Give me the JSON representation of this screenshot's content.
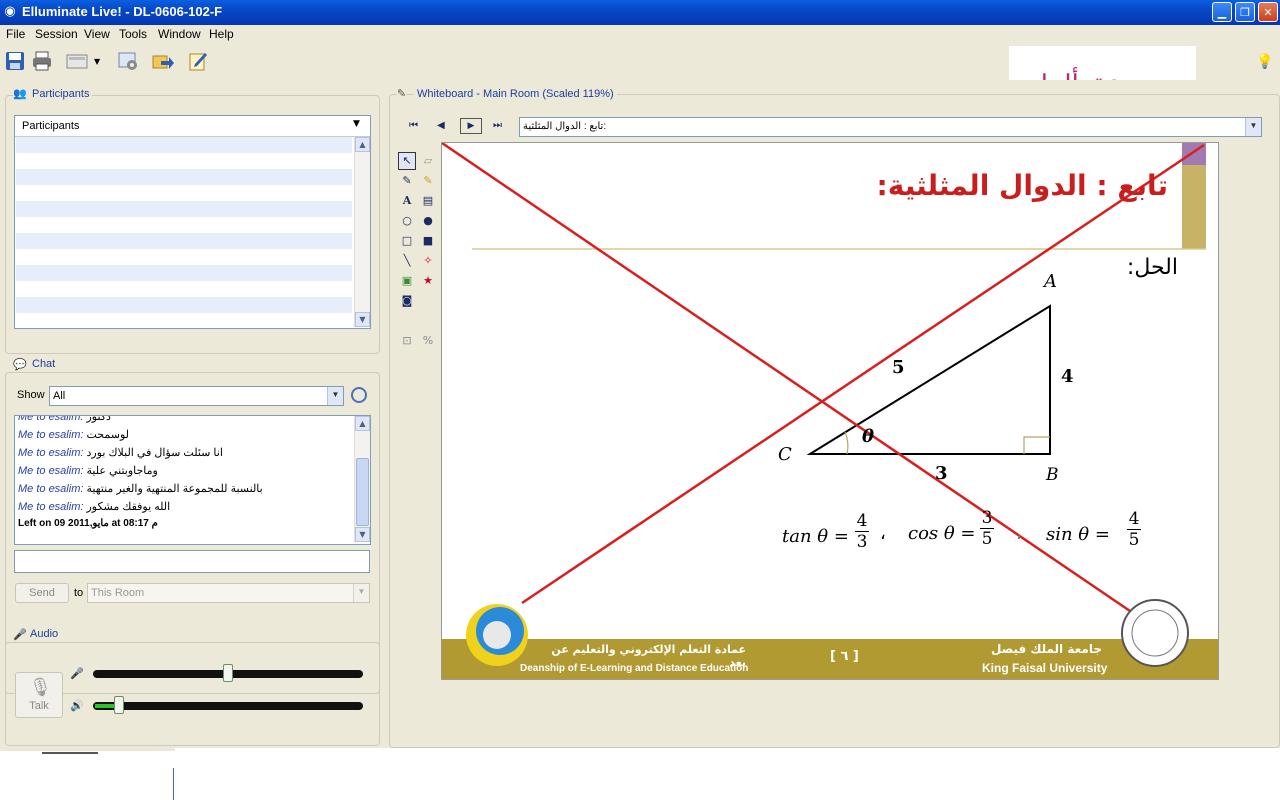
{
  "window": {
    "title": "Elluminate Live! - DL-0606-102-F"
  },
  "menu": [
    "File",
    "Session",
    "View",
    "Tools",
    "Window",
    "Help"
  ],
  "watermark": "عقدألماس",
  "participants": {
    "title": "Participants",
    "header": "Participants"
  },
  "chat": {
    "title": "Chat",
    "show_label": "Show",
    "show_value": "All",
    "messages": [
      {
        "who": "Me to esalim:",
        "text": "دكتور"
      },
      {
        "who": "Me to esalim:",
        "text": "لوسمحت"
      },
      {
        "who": "Me to esalim:",
        "text": "انا سئلت سؤال في البلاك بورد"
      },
      {
        "who": "Me to esalim:",
        "text": "وماجاوبتني علية"
      },
      {
        "who": "Me to esalim:",
        "text": "بالنسبة للمجموعة المنتهية والغير منتهية"
      },
      {
        "who": "Me to esalim:",
        "text": "الله يوفقك مشكور"
      }
    ],
    "status_line": "Left on 09 2011,مايو  at 08:17 م",
    "input_value": "",
    "send_label": "Send",
    "to_label": "to",
    "room_value": "This Room"
  },
  "audio": {
    "title": "Audio",
    "talk_label": "Talk",
    "mic_level": 0.5,
    "speaker_level": 0.08
  },
  "whiteboard": {
    "title": "Whiteboard - Main Room (Scaled 119%)",
    "page_value": "تابع : الدوال المثلثية:",
    "slide": {
      "heading": "تابع : الدوال المثلثية:",
      "solution_label": "الحل:",
      "vertex_a": "A",
      "vertex_b": "B",
      "vertex_c": "C",
      "side_hyp": "5",
      "side_vert": "4",
      "side_base": "3",
      "angle": "θ",
      "formula_tan": "tan θ =",
      "tan_num": "4",
      "tan_den": "3",
      "formula_cos": "cos θ =",
      "cos_num": "3",
      "cos_den": "5",
      "formula_sin": "sin θ =",
      "sin_num": "4",
      "sin_den": "5",
      "sep": "،",
      "footer_ar_left": "عمادة التعلم الإلكتروني والتعليم عن بعد",
      "footer_en_left": "Deanship of E-Learning and Distance Education",
      "page_number": "[ ٦ ]",
      "footer_ar_right": "جامعة الملك فيصل",
      "footer_en_right": "King Faisal University"
    }
  },
  "colors": {
    "titlebar": "#0747c6",
    "panel_bg": "#ece9d8",
    "cross_line": "#d81f1f",
    "footer_gold": "#b29a33",
    "heading_red": "#c81e1e"
  }
}
